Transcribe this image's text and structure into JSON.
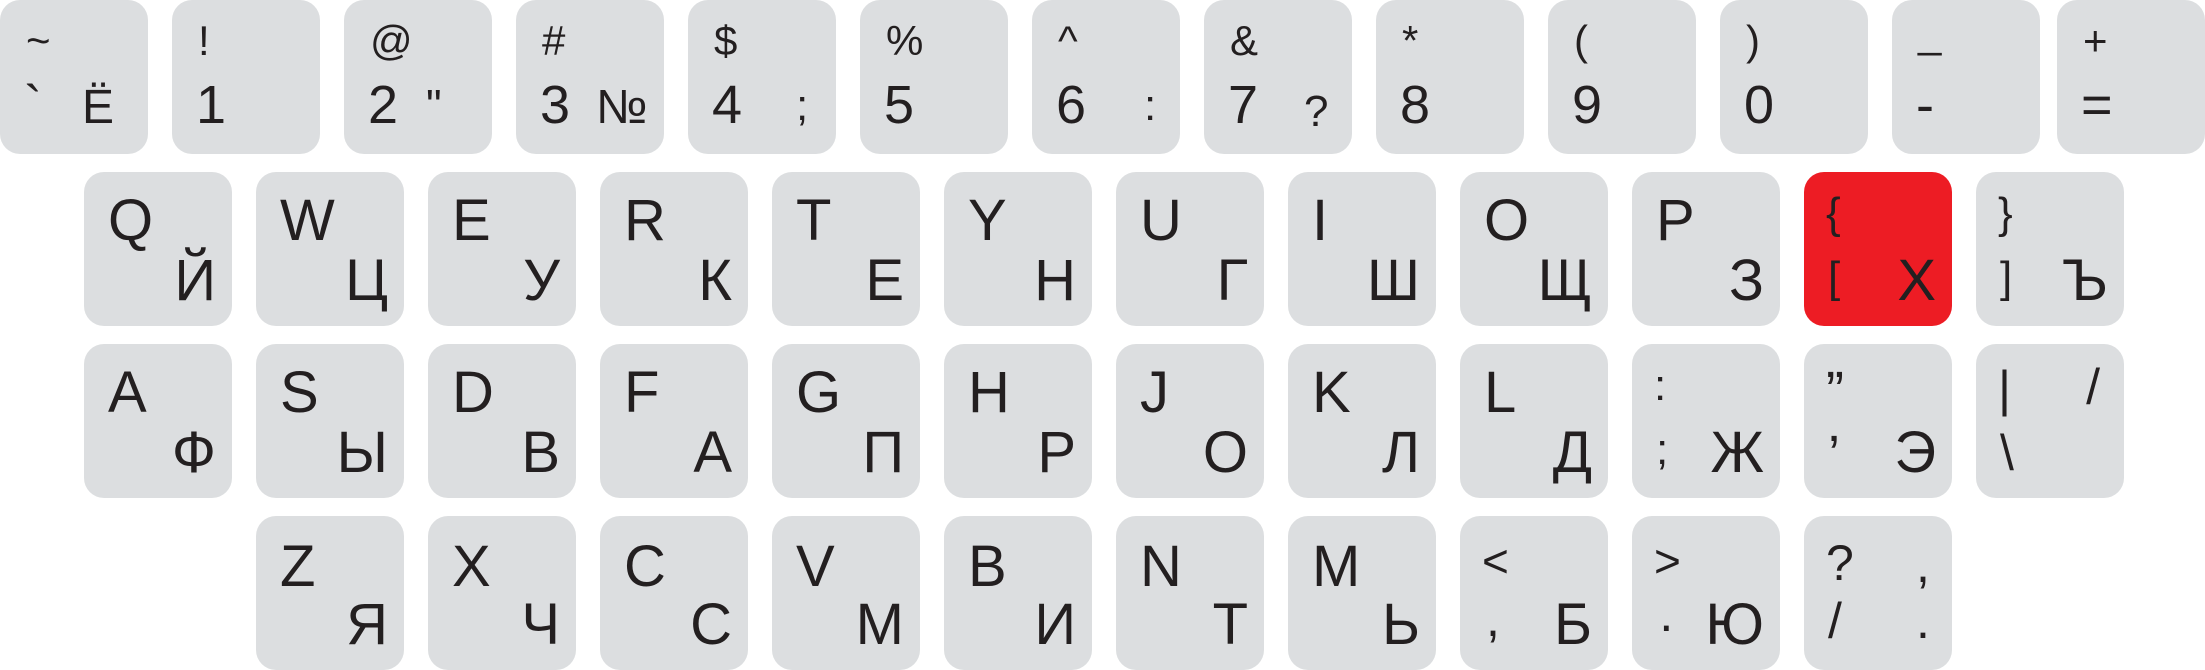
{
  "colors": {
    "key": "#dcdee0",
    "highlight": "#ed1c24",
    "text": "#231f20"
  },
  "row1": [
    {
      "shift": "~",
      "main": "`",
      "ru": "Ё"
    },
    {
      "shift": "!",
      "main": "1",
      "ru": ""
    },
    {
      "shift": "@",
      "main": "2",
      "ru": "\""
    },
    {
      "shift": "#",
      "main": "3",
      "ru": "№"
    },
    {
      "shift": "$",
      "main": "4",
      "ru": ";"
    },
    {
      "shift": "%",
      "main": "5",
      "ru": ""
    },
    {
      "shift": "^",
      "main": "6",
      "ru": ":"
    },
    {
      "shift": "&",
      "main": "7",
      "ru": "?"
    },
    {
      "shift": "*",
      "main": "8",
      "ru": ""
    },
    {
      "shift": "(",
      "main": "9",
      "ru": ""
    },
    {
      "shift": ")",
      "main": "0",
      "ru": ""
    },
    {
      "shift": "_",
      "main": "-",
      "ru": ""
    },
    {
      "shift": "+",
      "main": "=",
      "ru": ""
    }
  ],
  "row2": [
    {
      "en": "Q",
      "ru": "Й"
    },
    {
      "en": "W",
      "ru": "Ц"
    },
    {
      "en": "E",
      "ru": "У"
    },
    {
      "en": "R",
      "ru": "К"
    },
    {
      "en": "T",
      "ru": "Е"
    },
    {
      "en": "Y",
      "ru": "Н"
    },
    {
      "en": "U",
      "ru": "Г"
    },
    {
      "en": "I",
      "ru": "Ш"
    },
    {
      "en": "O",
      "ru": "Щ"
    },
    {
      "en": "P",
      "ru": "З"
    },
    {
      "sym_top": "{",
      "sym_bot": "[",
      "ru": "Х",
      "highlighted": true
    },
    {
      "sym_top": "}",
      "sym_bot": "]",
      "ru": "Ъ"
    }
  ],
  "row3": [
    {
      "en": "A",
      "ru": "Ф"
    },
    {
      "en": "S",
      "ru": "Ы"
    },
    {
      "en": "D",
      "ru": "В"
    },
    {
      "en": "F",
      "ru": "А"
    },
    {
      "en": "G",
      "ru": "П"
    },
    {
      "en": "H",
      "ru": "Р"
    },
    {
      "en": "J",
      "ru": "О"
    },
    {
      "en": "K",
      "ru": "Л"
    },
    {
      "en": "L",
      "ru": "Д"
    },
    {
      "sym_top": ":",
      "sym_bot": ";",
      "ru": "Ж"
    },
    {
      "sym_top": "”",
      "sym_bot": "’",
      "ru": "Э"
    },
    {
      "sym_top": "|",
      "sym_bot": "\\",
      "ru": "/"
    }
  ],
  "row4": [
    {
      "en": "Z",
      "ru": "Я"
    },
    {
      "en": "X",
      "ru": "Ч"
    },
    {
      "en": "C",
      "ru": "С"
    },
    {
      "en": "V",
      "ru": "М"
    },
    {
      "en": "B",
      "ru": "И"
    },
    {
      "en": "N",
      "ru": "Т"
    },
    {
      "en": "M",
      "ru": "Ь"
    },
    {
      "sym_top": "<",
      "sym_bot": ",",
      "ru": "Б"
    },
    {
      "sym_top": ">",
      "sym_bot": "·",
      "ru": "Ю"
    },
    {
      "sym_top": "?",
      "sym_bot": "/",
      "ru": ".",
      "ru_top": ","
    }
  ]
}
